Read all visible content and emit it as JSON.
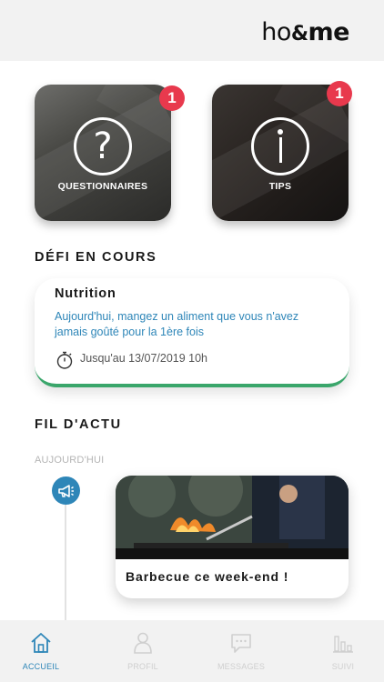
{
  "header": {
    "logo_text_left": "ho",
    "logo_text_amp": "&",
    "logo_text_right": "me"
  },
  "tiles": [
    {
      "label": "QUESTIONNAIRES",
      "badge": "1",
      "icon": "question-mark-icon"
    },
    {
      "label": "TIPS",
      "badge": "1",
      "icon": "info-icon"
    }
  ],
  "sections": {
    "defi_title": "DÉFI EN COURS",
    "feed_title": "FIL D'ACTU"
  },
  "defi": {
    "title": "Nutrition",
    "description": "Aujourd'hui, mangez un aliment que vous n'avez jamais goûté pour la 1ère fois",
    "deadline": "Jusqu'au 13/07/2019 10h",
    "accent_color": "#3aa66b"
  },
  "feed": {
    "day_label": "AUJOURD'HUI",
    "items": [
      {
        "title": "Barbecue ce week-end !",
        "icon": "megaphone-icon"
      }
    ]
  },
  "tabbar": {
    "items": [
      {
        "label": "ACCUEIL",
        "icon": "home-icon",
        "active": true
      },
      {
        "label": "PROFIL",
        "icon": "user-icon",
        "active": false
      },
      {
        "label": "MESSAGES",
        "icon": "chat-icon",
        "active": false
      },
      {
        "label": "SUIVI",
        "icon": "bar-chart-icon",
        "active": false
      }
    ]
  },
  "colors": {
    "accent_blue": "#2e86b8",
    "badge_red": "#e8394d",
    "challenge_green": "#3aa66b"
  }
}
